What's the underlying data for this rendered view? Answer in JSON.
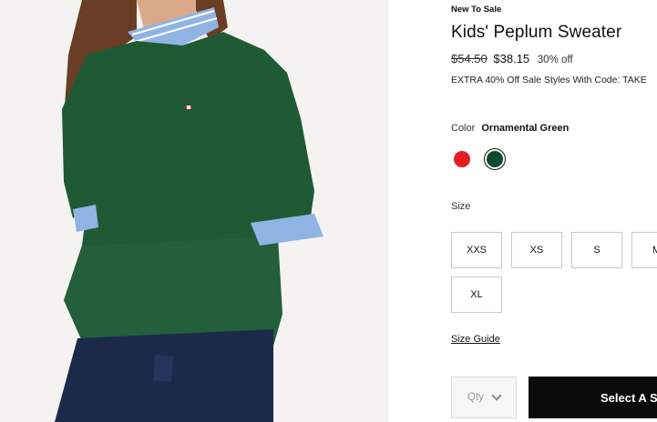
{
  "product": {
    "badge": "New To Sale",
    "title": "Kids' Peplum Sweater",
    "price_original": "$54.50",
    "price_sale": "$38.15",
    "discount": "30% off",
    "promo": "EXTRA 40% Off Sale Styles With Code: TAKE"
  },
  "color": {
    "label": "Color",
    "selected": "Ornamental Green",
    "swatches": [
      {
        "name": "red",
        "hex": "#e41d25"
      },
      {
        "name": "Ornamental Green",
        "hex": "#0e4a2e"
      }
    ]
  },
  "size": {
    "label": "Size",
    "options": [
      "XXS",
      "XS",
      "S",
      "M",
      "XL"
    ]
  },
  "size_guide": "Size Guide",
  "cart": {
    "qty_placeholder": "Qty",
    "select_label": "Select A Si"
  },
  "image": {
    "alt_icon": "product-photo"
  }
}
